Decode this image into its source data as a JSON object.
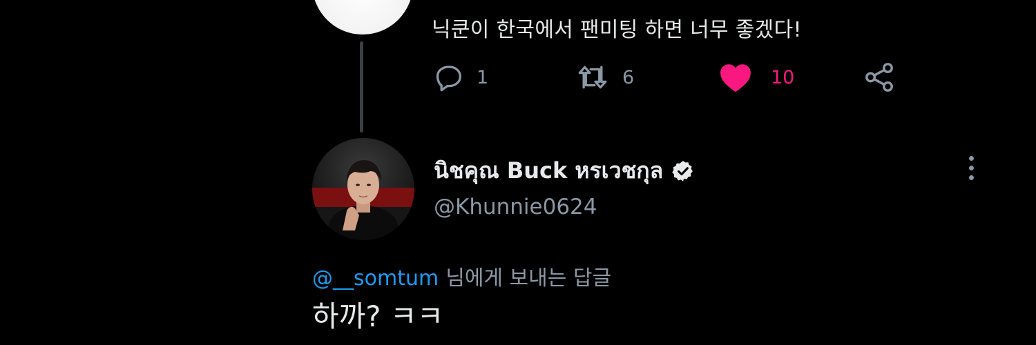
{
  "colors": {
    "background": "#000000",
    "text_primary": "#e7e9ea",
    "text_secondary": "#8b98a5",
    "like_active": "#f91880",
    "mention_blue": "#1d9bf0",
    "thread_line": "#3a3f44"
  },
  "parent_tweet": {
    "text": "닉쿤이 한국에서 팬미팅 하면 너무 좋겠다!",
    "actions": {
      "reply": {
        "icon": "reply-icon",
        "count": "1"
      },
      "retweet": {
        "icon": "retweet-icon",
        "count": "6"
      },
      "like": {
        "icon": "heart-filled-icon",
        "count": "10",
        "liked": true
      },
      "share": {
        "icon": "share-icon"
      }
    }
  },
  "reply_tweet": {
    "display_name": "นิชคุณ Buck หรเวชกุล",
    "verified": true,
    "handle": "@Khunnie0624",
    "replying_to_mention": "@__somtum",
    "replying_to_suffix": "님에게 보내는 답글",
    "text": "하까? ㅋㅋ"
  }
}
